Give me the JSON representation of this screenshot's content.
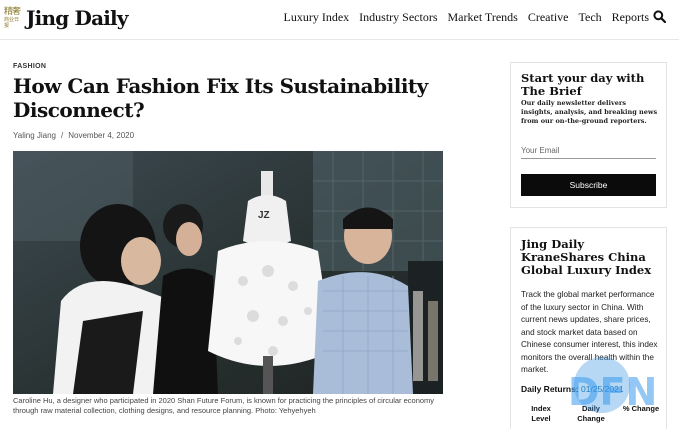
{
  "header": {
    "logo_chinese": "精奢",
    "logo_chinese_small": "商业日报",
    "logo_text": "Jing Daily",
    "nav": [
      "Luxury Index",
      "Industry Sectors",
      "Market Trends",
      "Creative",
      "Tech",
      "Reports"
    ]
  },
  "article": {
    "category": "FASHION",
    "title": "How Can Fashion Fix Its Sustainability Disconnect?",
    "author": "Yaling Jiang",
    "separator": "/",
    "date": "November 4, 2020",
    "image_tag": "JZ",
    "caption": "Caroline Hu, a designer who participated in 2020 Shan Future Forum, is known for practicing the principles of circular economy through raw material collection, clothing designs, and resource planning. Photo: Yehyehyeh"
  },
  "brief": {
    "title": "Start your day with The Brief",
    "description": "Our daily newsletter delivers insights, analysis, and breaking news from our on-the-ground reporters.",
    "email_placeholder": "Your Email",
    "button": "Subscribe"
  },
  "index": {
    "title": "Jing Daily KraneShares China Global Luxury Index",
    "description": "Track the global market performance of the luxury sector in China. With current news updates, share prices, and stock market data based on Chinese consumer interest, this index monitors the overall health within the market.",
    "daily_label": "Daily Returns:",
    "daily_date": "01/25/2021",
    "columns": [
      "Index Level",
      "Daily Change",
      "% Change"
    ]
  },
  "watermark": "DFN",
  "colors": {
    "accent_link": "#1a6fb0",
    "button_bg": "#0b0b0b",
    "logo_gold": "#8a7a2a"
  }
}
